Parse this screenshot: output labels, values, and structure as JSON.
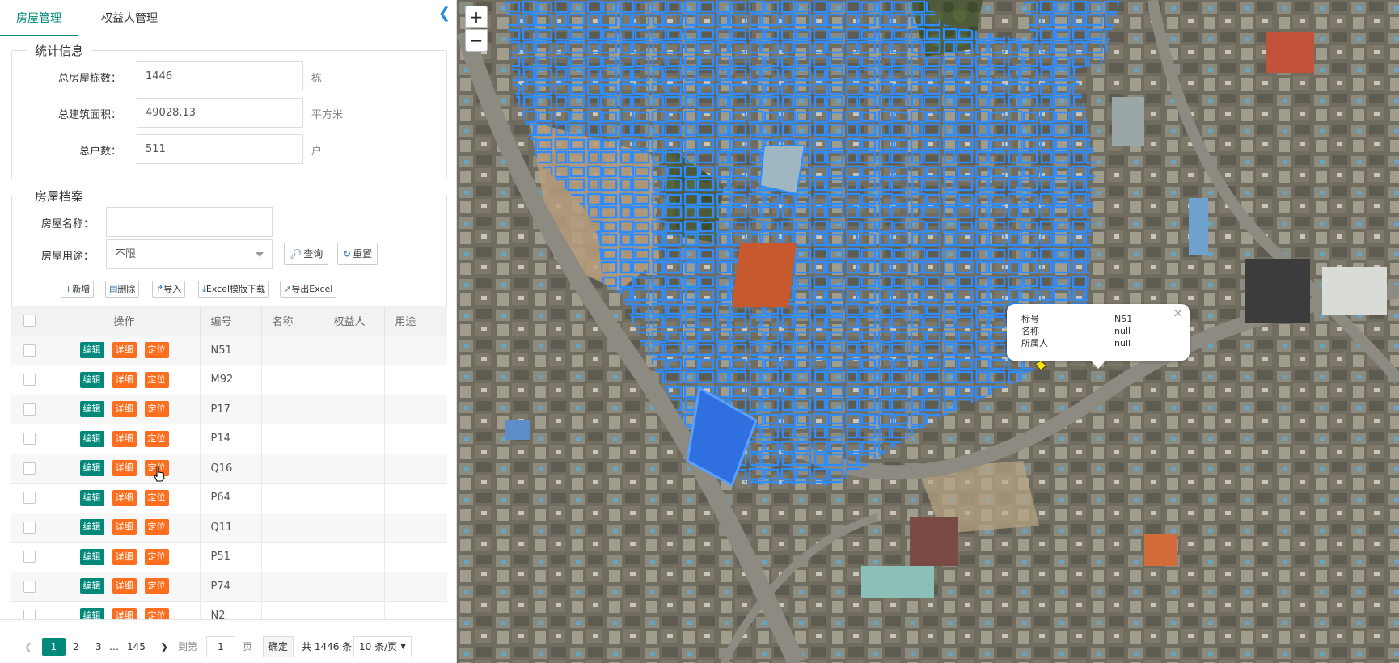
{
  "tabs": [
    "房屋管理",
    "权益人管理"
  ],
  "collapse_icon": "chevron-left-icon",
  "stats": {
    "legend": "统计信息",
    "rows": [
      {
        "label": "总房屋栋数：",
        "value": "1446",
        "unit": "栋"
      },
      {
        "label": "总建筑面积：",
        "value": "49028.13",
        "unit": "平方米"
      },
      {
        "label": "总户数：",
        "value": "511",
        "unit": "户"
      }
    ]
  },
  "archive": {
    "legend": "房屋档案",
    "name_label": "房屋名称：",
    "name_value": "",
    "use_label": "房屋用途：",
    "use_value": "不限",
    "query_label": "查询",
    "reset_label": "重置"
  },
  "toolbar": {
    "add": "新增",
    "delete": "删除",
    "import": "导入",
    "template": "Excel模版下载",
    "export": "导出Excel"
  },
  "table": {
    "headers": [
      "操作",
      "编号",
      "名称",
      "权益人",
      "用途"
    ],
    "op_labels": {
      "edit": "编辑",
      "detail": "详细",
      "locate": "定位"
    },
    "rows": [
      {
        "code": "N51",
        "name": "",
        "owner": "",
        "use": ""
      },
      {
        "code": "M92",
        "name": "",
        "owner": "",
        "use": ""
      },
      {
        "code": "P17",
        "name": "",
        "owner": "",
        "use": ""
      },
      {
        "code": "P14",
        "name": "",
        "owner": "",
        "use": ""
      },
      {
        "code": "Q16",
        "name": "",
        "owner": "",
        "use": ""
      },
      {
        "code": "P64",
        "name": "",
        "owner": "",
        "use": ""
      },
      {
        "code": "Q11",
        "name": "",
        "owner": "",
        "use": ""
      },
      {
        "code": "P51",
        "name": "",
        "owner": "",
        "use": ""
      },
      {
        "code": "P74",
        "name": "",
        "owner": "",
        "use": ""
      },
      {
        "code": "N2",
        "name": "",
        "owner": "",
        "use": ""
      }
    ]
  },
  "pager": {
    "pages": [
      "1",
      "2",
      "3",
      "…",
      "145"
    ],
    "current": "1",
    "goto_label": "到第",
    "goto_value": "1",
    "page_unit": "页",
    "confirm": "确定",
    "total": "共 1446 条",
    "page_size": "10 条/页"
  },
  "map": {
    "zoom_in": "+",
    "zoom_out": "−",
    "popup": {
      "rows": [
        {
          "key": "标号",
          "val": "N51"
        },
        {
          "key": "名称",
          "val": "null"
        },
        {
          "key": "所属人",
          "val": "null"
        }
      ],
      "close": "×"
    },
    "outline_color": "#2f8cff"
  },
  "colors": {
    "accent": "#00897b",
    "orange": "#ff6d1f",
    "link": "#2a6fb0"
  }
}
